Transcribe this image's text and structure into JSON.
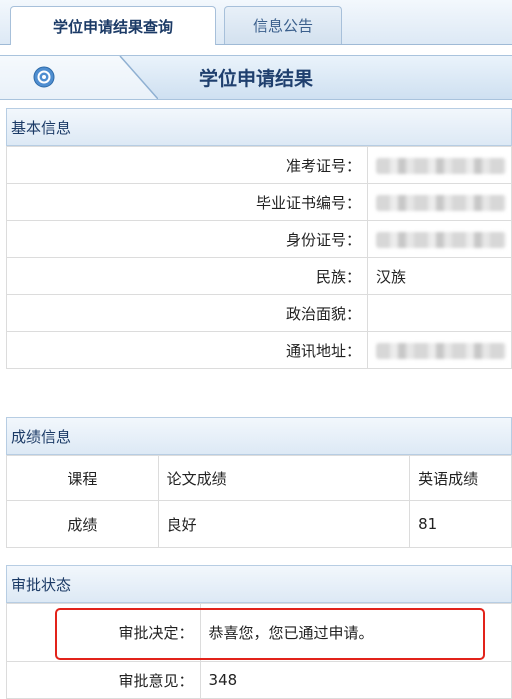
{
  "tabs": [
    {
      "label": "学位申请结果查询",
      "active": true
    },
    {
      "label": "信息公告",
      "active": false
    }
  ],
  "page": {
    "title": "学位申请结果",
    "icon": "gear-icon"
  },
  "basic_info": {
    "header": "基本信息",
    "rows": [
      {
        "label": "准考证号：",
        "value": ""
      },
      {
        "label": "毕业证书编号：",
        "value": ""
      },
      {
        "label": "身份证号：",
        "value": ""
      },
      {
        "label": "民族：",
        "value": "汉族"
      },
      {
        "label": "政治面貌：",
        "value": ""
      },
      {
        "label": "通讯地址：",
        "value": ""
      }
    ]
  },
  "scores": {
    "header": "成绩信息",
    "columns": [
      "课程",
      "论文成绩",
      "英语成绩"
    ],
    "row": [
      "成绩",
      "良好",
      "81"
    ]
  },
  "approval": {
    "header": "审批状态",
    "decision_label": "审批决定：",
    "decision_value": "恭喜您，您已通过申请。",
    "opinion_label": "审批意见：",
    "opinion_value": "348"
  },
  "colors": {
    "accent": "#1b3a66",
    "alert": "#e2231a",
    "header_bg": "#dde9f5"
  }
}
